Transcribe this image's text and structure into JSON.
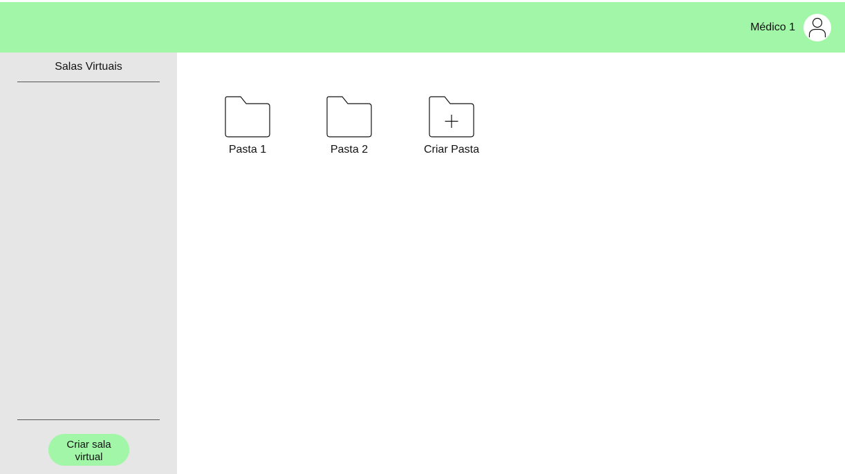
{
  "header": {
    "user_name": "Médico 1",
    "avatar_icon": "user-icon",
    "background_color": "#a1f7a7"
  },
  "sidebar": {
    "title": "Salas Virtuais",
    "create_room_label": "Criar sala\nvirtual",
    "background_color": "#e6e6e6",
    "items": []
  },
  "main": {
    "folders": [
      {
        "label": "Pasta 1",
        "icon": "folder-icon"
      },
      {
        "label": "Pasta 2",
        "icon": "folder-icon"
      },
      {
        "label": "Criar Pasta",
        "icon": "folder-add-icon"
      }
    ]
  }
}
